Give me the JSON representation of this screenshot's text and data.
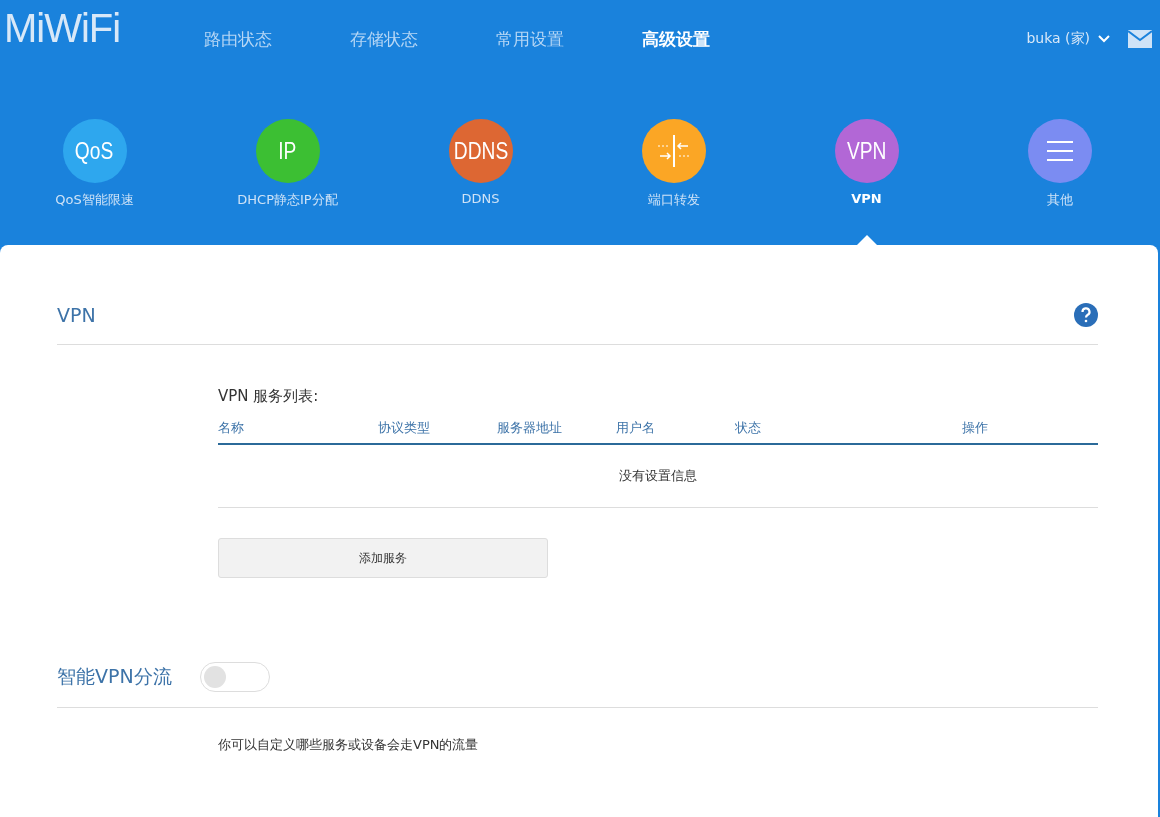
{
  "logo": "MiWiFi",
  "nav": [
    {
      "label": "路由状态",
      "selected": false
    },
    {
      "label": "存储状态",
      "selected": false
    },
    {
      "label": "常用设置",
      "selected": false
    },
    {
      "label": "高级设置",
      "selected": true
    }
  ],
  "user": {
    "name": "buka (家)"
  },
  "features": [
    {
      "kind": "text",
      "icon_text": "QoS",
      "label": "QoS智能限速",
      "color": "#2ea7ee",
      "selected": false
    },
    {
      "kind": "text",
      "icon_text": "IP",
      "label": "DHCP静态IP分配",
      "color": "#3cbf33",
      "selected": false
    },
    {
      "kind": "text",
      "icon_text": "DDNS",
      "label": "DDNS",
      "color": "#dd6733",
      "selected": false
    },
    {
      "kind": "ports",
      "label": "端口转发",
      "color": "#fba625",
      "selected": false
    },
    {
      "kind": "text",
      "icon_text": "VPN",
      "label": "VPN",
      "color": "#b267d6",
      "selected": true
    },
    {
      "kind": "menu",
      "label": "其他",
      "color": "#7b8cf2",
      "selected": false
    }
  ],
  "vpn_section": {
    "title": "VPN",
    "list_title": "VPN 服务列表:",
    "columns": [
      "名称",
      "协议类型",
      "服务器地址",
      "用户名",
      "状态",
      "操作"
    ],
    "empty_message": "没有设置信息",
    "add_button": "添加服务"
  },
  "smart_section": {
    "title": "智能VPN分流",
    "on": false,
    "description": "你可以自定义哪些服务或设备会走VPN的流量"
  }
}
